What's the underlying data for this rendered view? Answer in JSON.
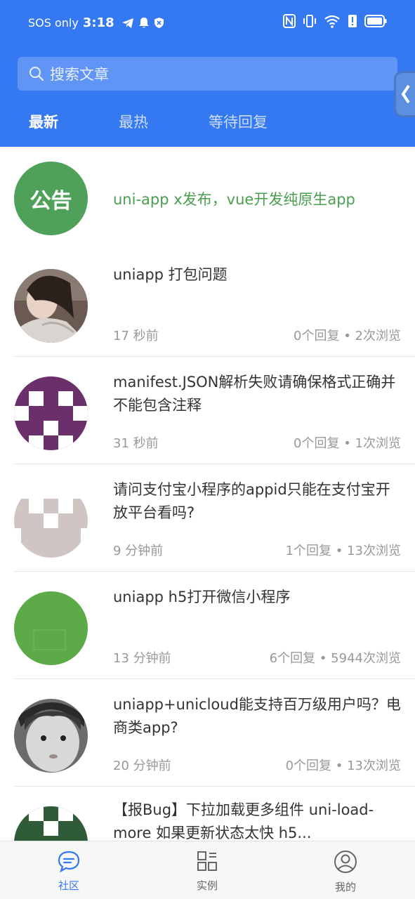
{
  "status_bar": {
    "carrier": "SOS only",
    "time": "3:18"
  },
  "search": {
    "placeholder": "搜索文章"
  },
  "tabs": [
    {
      "label": "最新",
      "active": true
    },
    {
      "label": "最热",
      "active": false
    },
    {
      "label": "等待回复",
      "active": false
    }
  ],
  "notice": {
    "badge": "公告",
    "text": "uni-app x发布，vue开发纯原生app"
  },
  "posts": [
    {
      "title": "uniapp 打包问题",
      "time": "17 秒前",
      "meta": "0个回复 • 2次浏览",
      "avatar": "photo-portrait"
    },
    {
      "title": "manifest.JSON解析失败请确保格式正确并不能包含注释",
      "time": "31 秒前",
      "meta": "0个回复 • 1次浏览",
      "avatar": "identicon-purple"
    },
    {
      "title": "请问支付宝小程序的appid只能在支付宝开放平台看吗?",
      "time": "9 分钟前",
      "meta": "1个回复 • 13次浏览",
      "avatar": "identicon-gray"
    },
    {
      "title": "uniapp h5打开微信小程序",
      "time": "13 分钟前",
      "meta": "6个回复 • 5944次浏览",
      "avatar": "solid-green"
    },
    {
      "title": "uniapp+unicloud能支持百万级用户吗？电商类app?",
      "time": "20 分钟前",
      "meta": "0个回复 • 13次浏览",
      "avatar": "photo-child"
    },
    {
      "title": "【报Bug】下拉加载更多组件 uni-load-more 如果更新状态太快 h5...",
      "time": "",
      "meta": "",
      "avatar": "identicon-darkgreen"
    }
  ],
  "bottom_nav": [
    {
      "label": "社区",
      "icon": "chat-bubble-icon",
      "active": true
    },
    {
      "label": "实例",
      "icon": "grid-icon",
      "active": false
    },
    {
      "label": "我的",
      "icon": "user-circle-icon",
      "active": false
    }
  ],
  "colors": {
    "header": "#3478f2",
    "notice_badge": "#4fa15a",
    "notice_text": "#4a9e4f",
    "nav_active": "#3478f2"
  }
}
